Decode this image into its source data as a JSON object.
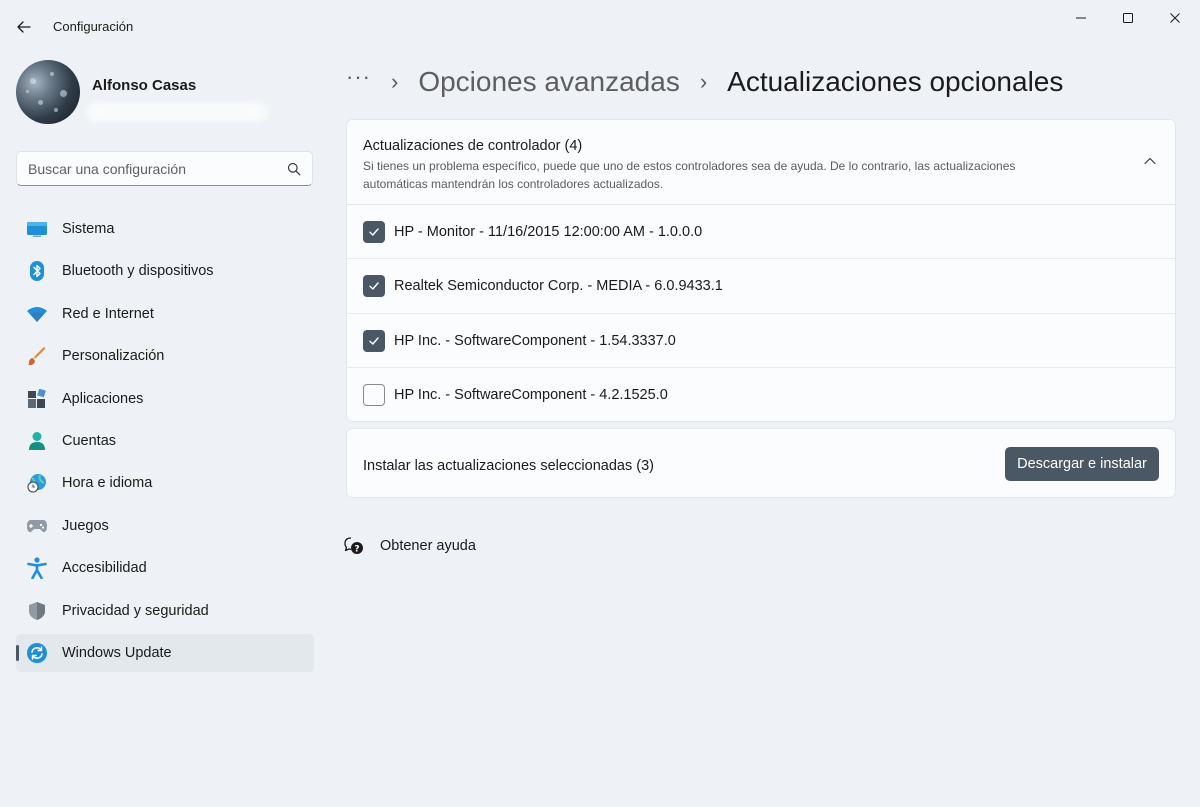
{
  "window": {
    "title": "Configuración"
  },
  "user": {
    "name": "Alfonso Casas"
  },
  "search": {
    "placeholder": "Buscar una configuración"
  },
  "sidebar": {
    "items": [
      {
        "label": "Sistema",
        "icon": "monitor-icon",
        "active": false
      },
      {
        "label": "Bluetooth y dispositivos",
        "icon": "bluetooth-icon",
        "active": false
      },
      {
        "label": "Red e Internet",
        "icon": "wifi-icon",
        "active": false
      },
      {
        "label": "Personalización",
        "icon": "paintbrush-icon",
        "active": false
      },
      {
        "label": "Aplicaciones",
        "icon": "apps-icon",
        "active": false
      },
      {
        "label": "Cuentas",
        "icon": "person-icon",
        "active": false
      },
      {
        "label": "Hora e idioma",
        "icon": "globe-clock-icon",
        "active": false
      },
      {
        "label": "Juegos",
        "icon": "gamepad-icon",
        "active": false
      },
      {
        "label": "Accesibilidad",
        "icon": "accessibility-icon",
        "active": false
      },
      {
        "label": "Privacidad y seguridad",
        "icon": "shield-icon",
        "active": false
      },
      {
        "label": "Windows Update",
        "icon": "windows-update-icon",
        "active": true
      }
    ]
  },
  "breadcrumb": {
    "more": "···",
    "parent": "Opciones avanzadas",
    "current": "Actualizaciones opcionales"
  },
  "drivers": {
    "title": "Actualizaciones de controlador (4)",
    "description": "Si tienes un problema específico, puede que uno de estos controladores sea de ayuda. De lo contrario, las actualizaciones automáticas mantendrán los controladores actualizados.",
    "items": [
      {
        "label": "HP - Monitor - 11/16/2015 12:00:00 AM - 1.0.0.0",
        "checked": true
      },
      {
        "label": "Realtek Semiconductor Corp. - MEDIA - 6.0.9433.1",
        "checked": true
      },
      {
        "label": "HP Inc. - SoftwareComponent - 1.54.3337.0",
        "checked": true
      },
      {
        "label": "HP Inc. - SoftwareComponent - 4.2.1525.0",
        "checked": false
      }
    ]
  },
  "install": {
    "label": "Instalar las actualizaciones seleccionadas (3)",
    "button": "Descargar e instalar"
  },
  "help": {
    "label": "Obtener ayuda"
  },
  "colors": {
    "accent": "#4a5866",
    "background": "#eef2f6",
    "card": "#fbfcfd"
  }
}
